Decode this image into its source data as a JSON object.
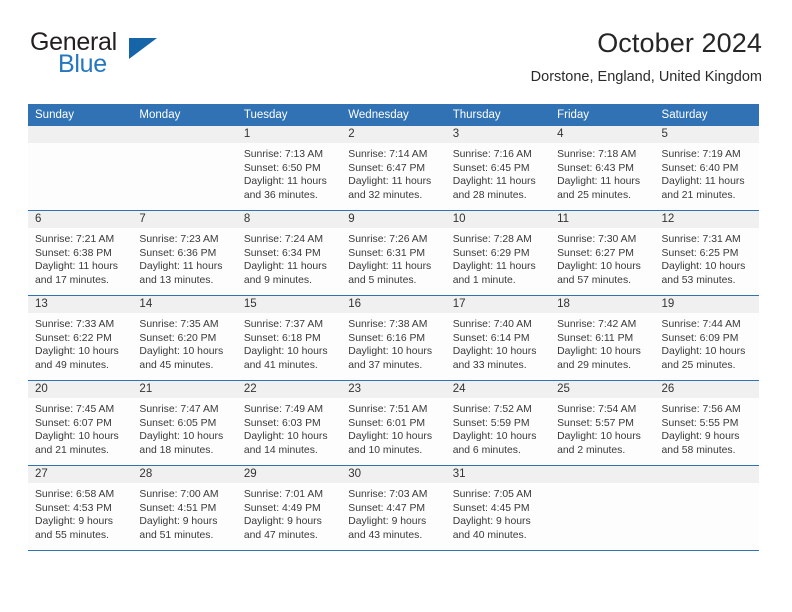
{
  "brand": {
    "name_top": "General",
    "name_bottom": "Blue",
    "triangle_color": "#1565a8",
    "blue_color": "#2577c0"
  },
  "header": {
    "title": "October 2024",
    "subtitle": "Dorstone, England, United Kingdom"
  },
  "theme": {
    "header_blue": "#3072b3",
    "daynum_band": "#f0f0f0",
    "cell_background": "#fdfdfd"
  },
  "calendar": {
    "weekday_headers": [
      "Sunday",
      "Monday",
      "Tuesday",
      "Wednesday",
      "Thursday",
      "Friday",
      "Saturday"
    ],
    "weeks": [
      [
        {
          "day": "",
          "lines": []
        },
        {
          "day": "",
          "lines": []
        },
        {
          "day": "1",
          "lines": [
            "Sunrise: 7:13 AM",
            "Sunset: 6:50 PM",
            "Daylight: 11 hours",
            "and 36 minutes."
          ]
        },
        {
          "day": "2",
          "lines": [
            "Sunrise: 7:14 AM",
            "Sunset: 6:47 PM",
            "Daylight: 11 hours",
            "and 32 minutes."
          ]
        },
        {
          "day": "3",
          "lines": [
            "Sunrise: 7:16 AM",
            "Sunset: 6:45 PM",
            "Daylight: 11 hours",
            "and 28 minutes."
          ]
        },
        {
          "day": "4",
          "lines": [
            "Sunrise: 7:18 AM",
            "Sunset: 6:43 PM",
            "Daylight: 11 hours",
            "and 25 minutes."
          ]
        },
        {
          "day": "5",
          "lines": [
            "Sunrise: 7:19 AM",
            "Sunset: 6:40 PM",
            "Daylight: 11 hours",
            "and 21 minutes."
          ]
        }
      ],
      [
        {
          "day": "6",
          "lines": [
            "Sunrise: 7:21 AM",
            "Sunset: 6:38 PM",
            "Daylight: 11 hours",
            "and 17 minutes."
          ]
        },
        {
          "day": "7",
          "lines": [
            "Sunrise: 7:23 AM",
            "Sunset: 6:36 PM",
            "Daylight: 11 hours",
            "and 13 minutes."
          ]
        },
        {
          "day": "8",
          "lines": [
            "Sunrise: 7:24 AM",
            "Sunset: 6:34 PM",
            "Daylight: 11 hours",
            "and 9 minutes."
          ]
        },
        {
          "day": "9",
          "lines": [
            "Sunrise: 7:26 AM",
            "Sunset: 6:31 PM",
            "Daylight: 11 hours",
            "and 5 minutes."
          ]
        },
        {
          "day": "10",
          "lines": [
            "Sunrise: 7:28 AM",
            "Sunset: 6:29 PM",
            "Daylight: 11 hours",
            "and 1 minute."
          ]
        },
        {
          "day": "11",
          "lines": [
            "Sunrise: 7:30 AM",
            "Sunset: 6:27 PM",
            "Daylight: 10 hours",
            "and 57 minutes."
          ]
        },
        {
          "day": "12",
          "lines": [
            "Sunrise: 7:31 AM",
            "Sunset: 6:25 PM",
            "Daylight: 10 hours",
            "and 53 minutes."
          ]
        }
      ],
      [
        {
          "day": "13",
          "lines": [
            "Sunrise: 7:33 AM",
            "Sunset: 6:22 PM",
            "Daylight: 10 hours",
            "and 49 minutes."
          ]
        },
        {
          "day": "14",
          "lines": [
            "Sunrise: 7:35 AM",
            "Sunset: 6:20 PM",
            "Daylight: 10 hours",
            "and 45 minutes."
          ]
        },
        {
          "day": "15",
          "lines": [
            "Sunrise: 7:37 AM",
            "Sunset: 6:18 PM",
            "Daylight: 10 hours",
            "and 41 minutes."
          ]
        },
        {
          "day": "16",
          "lines": [
            "Sunrise: 7:38 AM",
            "Sunset: 6:16 PM",
            "Daylight: 10 hours",
            "and 37 minutes."
          ]
        },
        {
          "day": "17",
          "lines": [
            "Sunrise: 7:40 AM",
            "Sunset: 6:14 PM",
            "Daylight: 10 hours",
            "and 33 minutes."
          ]
        },
        {
          "day": "18",
          "lines": [
            "Sunrise: 7:42 AM",
            "Sunset: 6:11 PM",
            "Daylight: 10 hours",
            "and 29 minutes."
          ]
        },
        {
          "day": "19",
          "lines": [
            "Sunrise: 7:44 AM",
            "Sunset: 6:09 PM",
            "Daylight: 10 hours",
            "and 25 minutes."
          ]
        }
      ],
      [
        {
          "day": "20",
          "lines": [
            "Sunrise: 7:45 AM",
            "Sunset: 6:07 PM",
            "Daylight: 10 hours",
            "and 21 minutes."
          ]
        },
        {
          "day": "21",
          "lines": [
            "Sunrise: 7:47 AM",
            "Sunset: 6:05 PM",
            "Daylight: 10 hours",
            "and 18 minutes."
          ]
        },
        {
          "day": "22",
          "lines": [
            "Sunrise: 7:49 AM",
            "Sunset: 6:03 PM",
            "Daylight: 10 hours",
            "and 14 minutes."
          ]
        },
        {
          "day": "23",
          "lines": [
            "Sunrise: 7:51 AM",
            "Sunset: 6:01 PM",
            "Daylight: 10 hours",
            "and 10 minutes."
          ]
        },
        {
          "day": "24",
          "lines": [
            "Sunrise: 7:52 AM",
            "Sunset: 5:59 PM",
            "Daylight: 10 hours",
            "and 6 minutes."
          ]
        },
        {
          "day": "25",
          "lines": [
            "Sunrise: 7:54 AM",
            "Sunset: 5:57 PM",
            "Daylight: 10 hours",
            "and 2 minutes."
          ]
        },
        {
          "day": "26",
          "lines": [
            "Sunrise: 7:56 AM",
            "Sunset: 5:55 PM",
            "Daylight: 9 hours",
            "and 58 minutes."
          ]
        }
      ],
      [
        {
          "day": "27",
          "lines": [
            "Sunrise: 6:58 AM",
            "Sunset: 4:53 PM",
            "Daylight: 9 hours",
            "and 55 minutes."
          ]
        },
        {
          "day": "28",
          "lines": [
            "Sunrise: 7:00 AM",
            "Sunset: 4:51 PM",
            "Daylight: 9 hours",
            "and 51 minutes."
          ]
        },
        {
          "day": "29",
          "lines": [
            "Sunrise: 7:01 AM",
            "Sunset: 4:49 PM",
            "Daylight: 9 hours",
            "and 47 minutes."
          ]
        },
        {
          "day": "30",
          "lines": [
            "Sunrise: 7:03 AM",
            "Sunset: 4:47 PM",
            "Daylight: 9 hours",
            "and 43 minutes."
          ]
        },
        {
          "day": "31",
          "lines": [
            "Sunrise: 7:05 AM",
            "Sunset: 4:45 PM",
            "Daylight: 9 hours",
            "and 40 minutes."
          ]
        },
        {
          "day": "",
          "lines": []
        },
        {
          "day": "",
          "lines": []
        }
      ]
    ]
  }
}
